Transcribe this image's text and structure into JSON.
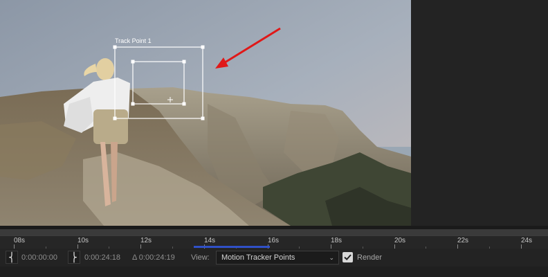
{
  "viewer": {
    "track_point_label": "Track Point 1",
    "arrow_color": "#e01818"
  },
  "timeline": {
    "ticks": [
      "08s",
      "10s",
      "12s",
      "14s",
      "16s",
      "18s",
      "20s",
      "22s",
      "24s"
    ]
  },
  "controls": {
    "in_icon": "in-point-bracket-icon",
    "in_time": "0:00:00:00",
    "out_icon": "out-point-bracket-icon",
    "out_time": "0:00:24:18",
    "duration": "Δ 0:00:24:19",
    "view_label": "View:",
    "view_value": "Motion Tracker Points",
    "render_label": "Render",
    "render_checked": true
  }
}
